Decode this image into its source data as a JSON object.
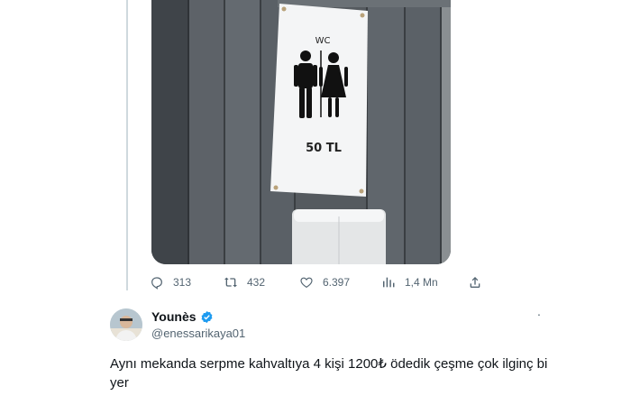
{
  "media": {
    "sign_title": "WC",
    "sign_price": "50 TL"
  },
  "actions": {
    "replies": "313",
    "retweets": "432",
    "likes": "6.397",
    "views": "1,4 Mn"
  },
  "icons": {
    "reply": "reply-icon",
    "retweet": "retweet-icon",
    "like": "heart-icon",
    "views": "views-icon",
    "share": "share-icon",
    "verified": "verified-badge-icon",
    "more": "more-icon"
  },
  "reply": {
    "display_name": "Younès",
    "handle": "@enessarikaya01",
    "more": "·",
    "text": "Aynı mekanda serpme kahvaltıya 4 kişi 1200₺ ödedik çeşme çok ilginç bi yer"
  },
  "colors": {
    "text": "#0f1419",
    "secondary": "#536471",
    "verified": "#1d9bf0"
  }
}
